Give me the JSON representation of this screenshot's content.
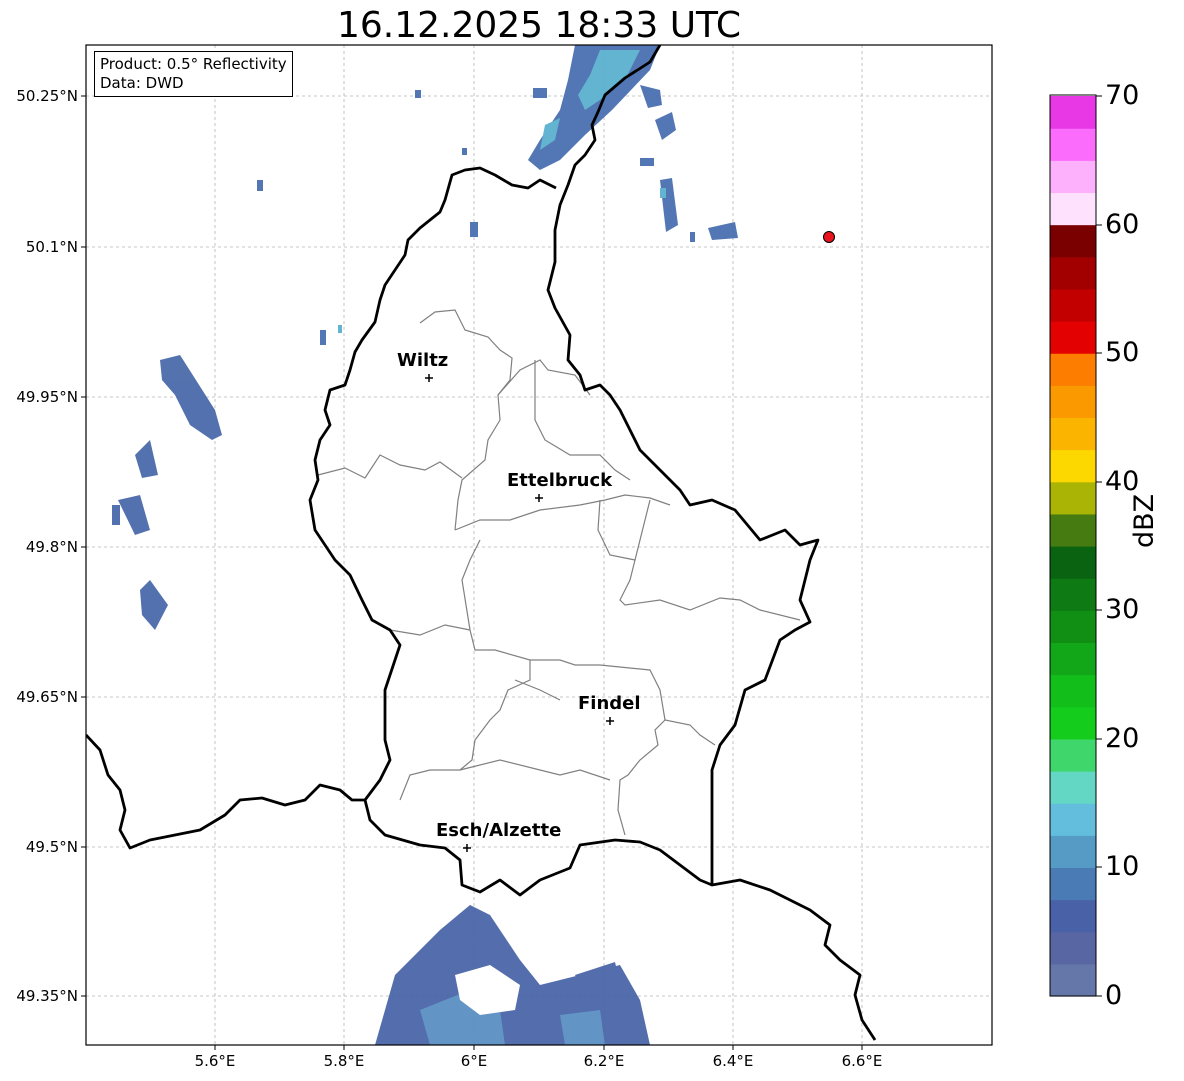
{
  "title": "16.12.2025 18:33 UTC",
  "info_box": {
    "product": "Product: 0.5° Reflectivity",
    "data": "Data: DWD"
  },
  "lat_labels": [
    "50.25°N",
    "50.1°N",
    "49.95°N",
    "49.8°N",
    "49.65°N",
    "49.5°N",
    "49.35°N"
  ],
  "lon_labels": [
    "5.6°E",
    "5.8°E",
    "6°E",
    "6.2°E",
    "6.4°E",
    "6.6°E"
  ],
  "cities": [
    {
      "name": "Wiltz",
      "lon": 5.93,
      "lat": 49.967
    },
    {
      "name": "Ettelbruck",
      "lon": 6.104,
      "lat": 49.847
    },
    {
      "name": "Findel",
      "lon": 6.211,
      "lat": 49.627
    },
    {
      "name": "Esch/Alzette",
      "lon": 5.98,
      "lat": 49.496
    }
  ],
  "radar_site_marker": {
    "lon": 6.548,
    "lat": 50.109,
    "color": "#e8141e"
  },
  "colorbar": {
    "label": "dBZ",
    "ticks": [
      "0",
      "10",
      "20",
      "30",
      "40",
      "50",
      "60",
      "70"
    ],
    "colors": [
      "#6577a8",
      "#5867a3",
      "#4961a6",
      "#4a7bb4",
      "#559bc6",
      "#63bddc",
      "#63d6c4",
      "#3fd66b",
      "#13cc1c",
      "#12be1a",
      "#12a718",
      "#118f15",
      "#0e7a13",
      "#0a6310",
      "#457b11",
      "#aab405",
      "#fcd800",
      "#fbb500",
      "#fb9a00",
      "#fd7d00",
      "#e30101",
      "#c20000",
      "#a20000",
      "#7a0000",
      "#fde1fd",
      "#fdb1fd",
      "#fc6cfc",
      "#e838e6"
    ]
  }
}
